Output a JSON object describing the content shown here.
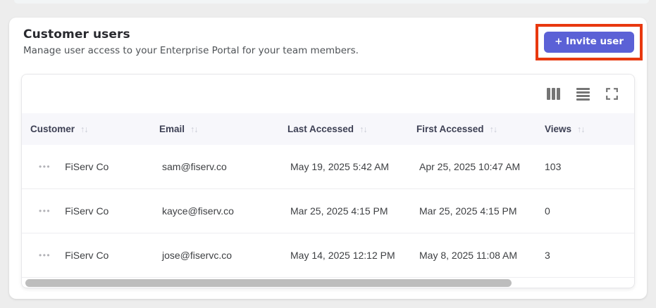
{
  "header": {
    "title": "Customer users",
    "subtitle": "Manage user access to your Enterprise Portal for your team members.",
    "invite_button_label": "+ Invite user"
  },
  "colors": {
    "accent_button": "#5b61d6",
    "annotation_highlight": "#e8380f",
    "table_header_bg": "#f7f7fb",
    "page_bg": "#ededed"
  },
  "table": {
    "toolbar_icons": [
      "columns-icon",
      "rows-density-icon",
      "fullscreen-icon"
    ],
    "icons": {
      "sort": "↑↓",
      "row_menu": "•••"
    },
    "columns": [
      {
        "label": "Customer",
        "sortable": true
      },
      {
        "label": "Email",
        "sortable": true
      },
      {
        "label": "Last Accessed",
        "sortable": true
      },
      {
        "label": "First Accessed",
        "sortable": true
      },
      {
        "label": "Views",
        "sortable": true
      }
    ],
    "rows": [
      {
        "customer": "FiServ Co",
        "email": "sam@fiserv.co",
        "last_accessed": "May 19, 2025 5:42 AM",
        "first_accessed": "Apr 25, 2025 10:47 AM",
        "views": "103"
      },
      {
        "customer": "FiServ Co",
        "email": "kayce@fiserv.co",
        "last_accessed": "Mar 25, 2025 4:15 PM",
        "first_accessed": "Mar 25, 2025 4:15 PM",
        "views": "0"
      },
      {
        "customer": "FiServ Co",
        "email": "jose@fiservc.co",
        "last_accessed": "May 14, 2025 12:12 PM",
        "first_accessed": "May 8, 2025 11:08 AM",
        "views": "3"
      }
    ]
  }
}
